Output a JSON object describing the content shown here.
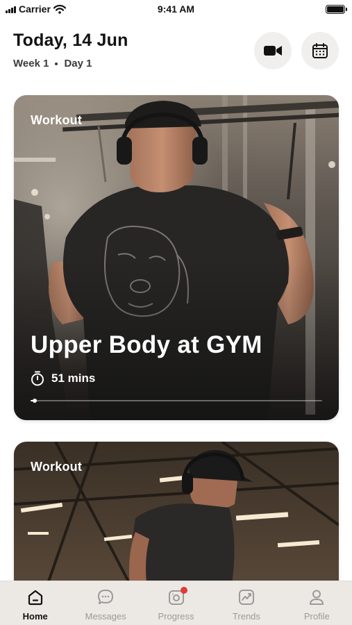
{
  "status_bar": {
    "carrier": "Carrier",
    "time": "9:41 AM"
  },
  "header": {
    "date_title": "Today, 14 Jun",
    "week": "Week 1",
    "day": "Day 1",
    "video_button_icon": "video-camera-icon",
    "calendar_button_icon": "calendar-icon"
  },
  "cards": [
    {
      "label": "Workout",
      "title": "Upper Body at GYM",
      "duration": "51 mins",
      "progress": 0.01,
      "duration_icon": "stopwatch-icon"
    },
    {
      "label": "Workout"
    }
  ],
  "tabs": [
    {
      "label": "Home",
      "icon": "home-icon",
      "active": true
    },
    {
      "label": "Messages",
      "icon": "chat-bubble-icon",
      "active": false
    },
    {
      "label": "Progress",
      "icon": "camera-icon",
      "active": false,
      "badge": true
    },
    {
      "label": "Trends",
      "icon": "trend-chart-icon",
      "active": false
    },
    {
      "label": "Profile",
      "icon": "person-icon",
      "active": false
    }
  ],
  "colors": {
    "badge": "#e53935",
    "tabbar_bg": "#ece9e4",
    "header_button_bg": "#f0efed"
  }
}
